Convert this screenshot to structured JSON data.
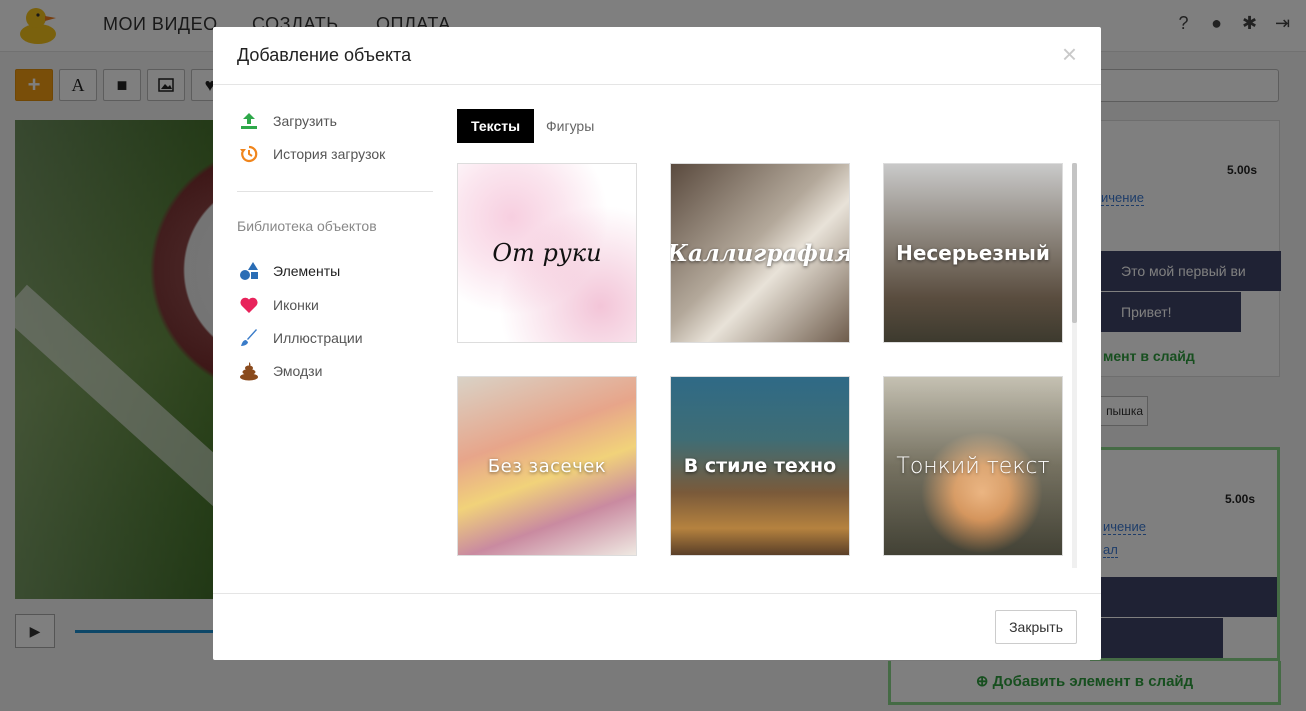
{
  "app": {
    "nav": [
      "МОИ ВИДЕО",
      "СОЗДАТЬ",
      "ОПЛАТА"
    ]
  },
  "right_panel": {
    "slide1": {
      "time": "5.00s",
      "link1": "ичение",
      "row_text1": "Это мой первый ви",
      "row_text2": "Привет!",
      "add_label": "мент в слайд"
    },
    "small_button": "пышка",
    "slide2": {
      "time": "5.00s",
      "link1": "ичение",
      "link2": "ал"
    },
    "add_element_label": "Добавить элемент в слайд"
  },
  "modal": {
    "title": "Добавление объекта",
    "close_symbol": "×",
    "sidebar": {
      "upload_label": "Загрузить",
      "history_label": "История загрузок",
      "library_heading": "Библиотека объектов",
      "items": [
        {
          "label": "Элементы",
          "icon": "shapes-icon"
        },
        {
          "label": "Иконки",
          "icon": "heart-icon"
        },
        {
          "label": "Иллюстрации",
          "icon": "brush-icon"
        },
        {
          "label": "Эмодзи",
          "icon": "poop-emoji-icon"
        }
      ]
    },
    "tabs": [
      "Тексты",
      "Фигуры"
    ],
    "active_tab": "Тексты",
    "tiles": [
      "От руки",
      "Каллиграфия",
      "Несерьезный",
      "Без засечек",
      "В стиле техно",
      "Тонкий текст"
    ],
    "footer": {
      "close_label": "Закрыть"
    },
    "colors": {
      "upload_icon": "#2ea84a",
      "history_icon": "#f0851c",
      "shapes_icon": "#2a6db5",
      "heart_icon": "#e8235b",
      "brush_icon": "#3a7cc9",
      "emoji_icon": "#8a4a1c"
    }
  }
}
